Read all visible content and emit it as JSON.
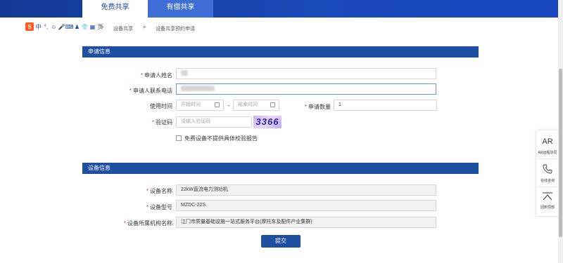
{
  "tabs": {
    "free": "免费共享",
    "paid": "有偿共享"
  },
  "toolbar": {
    "logo": "S",
    "zh": "中",
    "punct": "°,",
    "emoji": "☺",
    "mic": "🎤",
    "kbd": "⌨",
    "person": "♟",
    "shirt": "👕",
    "grid": "▦",
    "tail": "页"
  },
  "breadcrumb": {
    "sep1": ">",
    "item1": "设备共享",
    "sep2": ">",
    "item2": "设备共享预约申请"
  },
  "section1": {
    "title": "申请信息"
  },
  "form": {
    "name_label": "申请人姓名",
    "phone_label": "申请人联系电话",
    "time_label": "使用时间",
    "start_ph": "开始时间",
    "dash": "-",
    "end_ph": "结束时间",
    "qty_label": "申请数量",
    "qty_value": "1",
    "captcha_label": "验证码",
    "captcha_ph": "请输入验证码",
    "captcha_code": "3366",
    "checkbox_label": "免费设备不提供具体校验报告",
    "required_mark": "*"
  },
  "section2": {
    "title": "设备信息"
  },
  "device": {
    "name_label": "设备名称",
    "name_value": "22kW直流电力测功机",
    "model_label": "设备型号",
    "model_value": "MZDC-22S",
    "org_label": "设备所属机构名称",
    "org_value": "江门市质量基础设施一站式服务平台(摩托车及配件产业集群)"
  },
  "submit": "提交",
  "side": {
    "ar": "AR",
    "ar_label": "AR远程协同",
    "phone_label": "在线咨询",
    "top_label": "回到顶部"
  },
  "colors": {
    "nav": "#1a49b8",
    "section": "#1d4fa3",
    "required": "#e23a3a"
  }
}
